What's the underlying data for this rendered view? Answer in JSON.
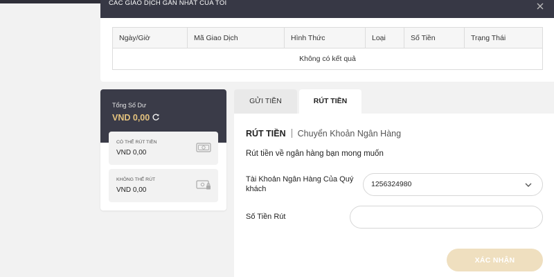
{
  "recent": {
    "title": "CÁC GIAO DỊCH GẦN NHẤT CỦA TÔI",
    "table": {
      "columns": [
        "Ngày/Giờ",
        "Mã Giao Dịch",
        "Hình Thức",
        "Loại",
        "Số Tiền",
        "Trạng Thái"
      ],
      "empty_text": "Không có kết quả"
    }
  },
  "balance": {
    "total_label": "Tổng Số Dư",
    "total_value": "VND 0,00",
    "withdrawable_label": "CÓ THỂ RÚT TIỀN",
    "withdrawable_value": "VND 0,00",
    "non_withdrawable_label": "KHÔNG THỂ RÚT",
    "non_withdrawable_value": "VND 0,00",
    "accent_color": "#e5c37e"
  },
  "tabs": [
    {
      "label": "GỬI TIỀN",
      "active": false
    },
    {
      "label": "RÚT TIỀN",
      "active": true
    }
  ],
  "form": {
    "title": "RÚT TIỀN",
    "subtitle": "Chuyển Khoản Ngân Hàng",
    "description": "Rút tiền về ngân hàng bạn mong muốn",
    "bank_account_label": "Tài Khoản Ngân Hàng Của Quý khách",
    "bank_account_value": "1256324980",
    "amount_label": "Số Tiền Rút",
    "amount_value": "",
    "confirm_label": "XÁC NHẬN"
  },
  "icons": {
    "close": "close-icon",
    "refresh": "refresh-icon",
    "cash": "cash-icon",
    "cash_locked": "cash-lock-icon",
    "dropdown": "chevron-down-icon"
  },
  "colors": {
    "dark_header": "#373845",
    "button_disabled": "#efdfbf"
  }
}
